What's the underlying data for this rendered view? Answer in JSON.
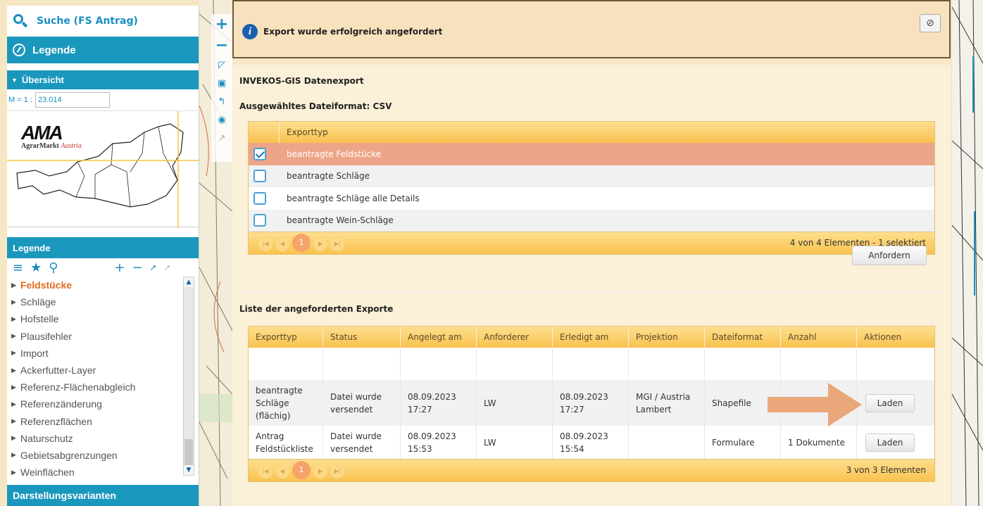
{
  "sidebar": {
    "search_label": "Suche  (FS Antrag)",
    "legende_top": "Legende",
    "uebersicht": "Übersicht",
    "scale_prefix": "M = 1 :",
    "scale_value": "23.014",
    "logo_word": "AMA",
    "logo_sub": "AgrarMarkt",
    "logo_sub2": "Austria",
    "legende_head": "Legende",
    "legend_items": [
      "Feldstücke",
      "Schläge",
      "Hofstelle",
      "Plausifehler",
      "Import",
      "Ackerfutter-Layer",
      "Referenz-Flächenabgleich",
      "Referenzänderung",
      "Referenzflächen",
      "Naturschutz",
      "Gebietsabgrenzungen",
      "Weinflächen"
    ],
    "darstellung": "Darstellungsvarianten"
  },
  "info": {
    "message": "Export wurde erfolgreich angefordert",
    "close_icon": "⊘"
  },
  "export": {
    "title": "INVEKOS-GIS Datenexport",
    "format_label": "Ausgewähltes Dateiformat: CSV",
    "header": "Exporttyp",
    "rows": [
      {
        "label": "beantragte Feldstücke",
        "checked": true
      },
      {
        "label": "beantragte Schläge",
        "checked": false
      },
      {
        "label": "beantragte Schläge alle Details",
        "checked": false
      },
      {
        "label": "beantragte Wein-Schläge",
        "checked": false
      }
    ],
    "page": "1",
    "footer_info": "4 von 4 Elementen - 1 selektiert",
    "anfordern": "Anfordern"
  },
  "list": {
    "title": "Liste der angeforderten Exporte",
    "headers": [
      "Exporttyp",
      "Status",
      "Angelegt am",
      "Anforderer",
      "Erledigt am",
      "Projektion",
      "Dateiformat",
      "Anzahl",
      "Aktionen"
    ],
    "rows": [
      [
        "beantragte\nSchläge\n(flächig)",
        "Datei wurde\nversendet",
        "08.09.2023\n17:27",
        "LW",
        "08.09.2023\n17:27",
        "MGI / Austria\nLambert",
        "Shapefile",
        "",
        "Laden"
      ],
      [
        "Antrag\nFeldstückliste",
        "Datei wurde\nversendet",
        "08.09.2023\n15:53",
        "LW",
        "08.09.2023\n15:54",
        "",
        "Formulare",
        "1 Dokumente",
        "Laden"
      ]
    ],
    "page": "1",
    "footer_info": "3 von 3 Elementen"
  },
  "colors": {
    "teal": "#1a97bc",
    "selected_row": "#eda589",
    "arrow": "#e9a77a"
  }
}
